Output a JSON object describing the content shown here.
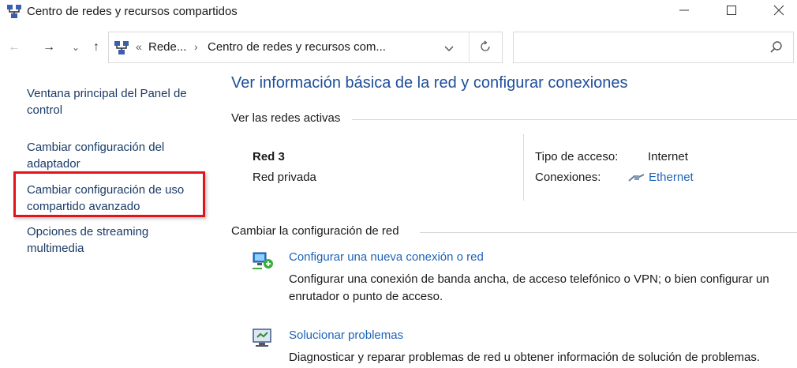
{
  "window": {
    "title": "Centro de redes y recursos compartidos",
    "minimize_icon": "minimize-icon",
    "maximize_icon": "maximize-icon",
    "close_icon": "close-icon"
  },
  "address_bar": {
    "overflow_marker": "«",
    "crumbs": [
      "Rede...",
      "Centro de redes y recursos com..."
    ],
    "separator": "›",
    "search_placeholder": ""
  },
  "left_nav": {
    "items": [
      "Ventana principal del Panel de control",
      "Cambiar configuración del adaptador",
      "Cambiar configuración de uso compartido avanzado",
      "Opciones de streaming multimedia"
    ],
    "highlight_color": "#e2141b"
  },
  "main": {
    "title": "Ver información básica de la red y configurar conexiones",
    "active_networks_header": "Ver las redes activas",
    "network": {
      "name": "Red 3",
      "profile": "Red privada",
      "access_type_label": "Tipo de acceso:",
      "access_type_value": "Internet",
      "connections_label": "Conexiones:",
      "connections_value": "Ethernet"
    },
    "change_header": "Cambiar la configuración de red",
    "tasks": [
      {
        "title": "Configurar una nueva conexión o red",
        "description": "Configurar una conexión de banda ancha, de acceso telefónico o VPN; o bien configurar un enrutador o punto de acceso.",
        "icon": "new-connection-icon"
      },
      {
        "title": "Solucionar problemas",
        "description": "Diagnosticar y reparar problemas de red u obtener información de solución de problemas.",
        "icon": "troubleshoot-icon"
      }
    ]
  },
  "colors": {
    "title_blue": "#1e4e9a",
    "link_blue": "#1e63b8",
    "nav_link": "#1a3b67"
  }
}
